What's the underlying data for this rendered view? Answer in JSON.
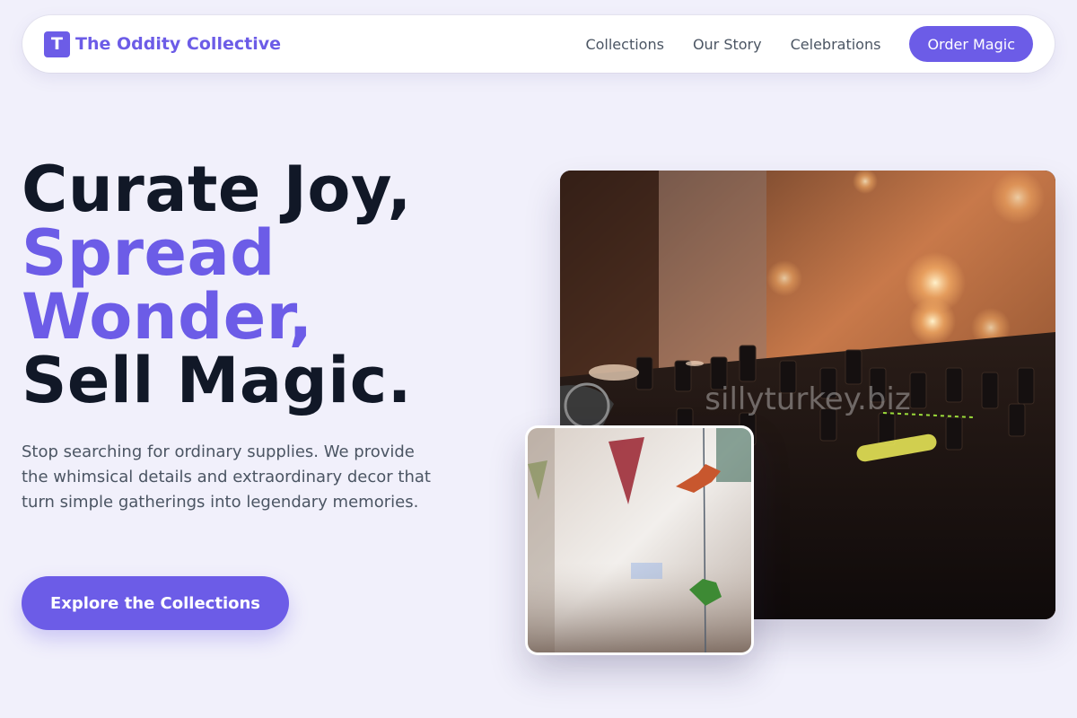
{
  "brand": {
    "mark": "T",
    "name": "The Oddity Collective"
  },
  "nav": {
    "links": [
      "Collections",
      "Our Story",
      "Celebrations"
    ],
    "cta_label": "Order Magic"
  },
  "hero": {
    "headline_line1": "Curate Joy,",
    "headline_line2": "Spread",
    "headline_line3": "Wonder,",
    "headline_line4": "Sell Magic.",
    "lede": "Stop searching for ordinary supplies. We provide the whimsical details and extraordinary decor that turn simple gatherings into legendary memories.",
    "cta_label": "Explore the Collections"
  },
  "images": {
    "main_watermark": "sillyturkey.biz",
    "main_subject": "dj-mixer-photo",
    "small_subject": "party-bunting-photo"
  },
  "colors": {
    "accent": "#6c5ce7",
    "background": "#f1f0fb",
    "heading": "#111827",
    "body_text": "#4b5563"
  }
}
